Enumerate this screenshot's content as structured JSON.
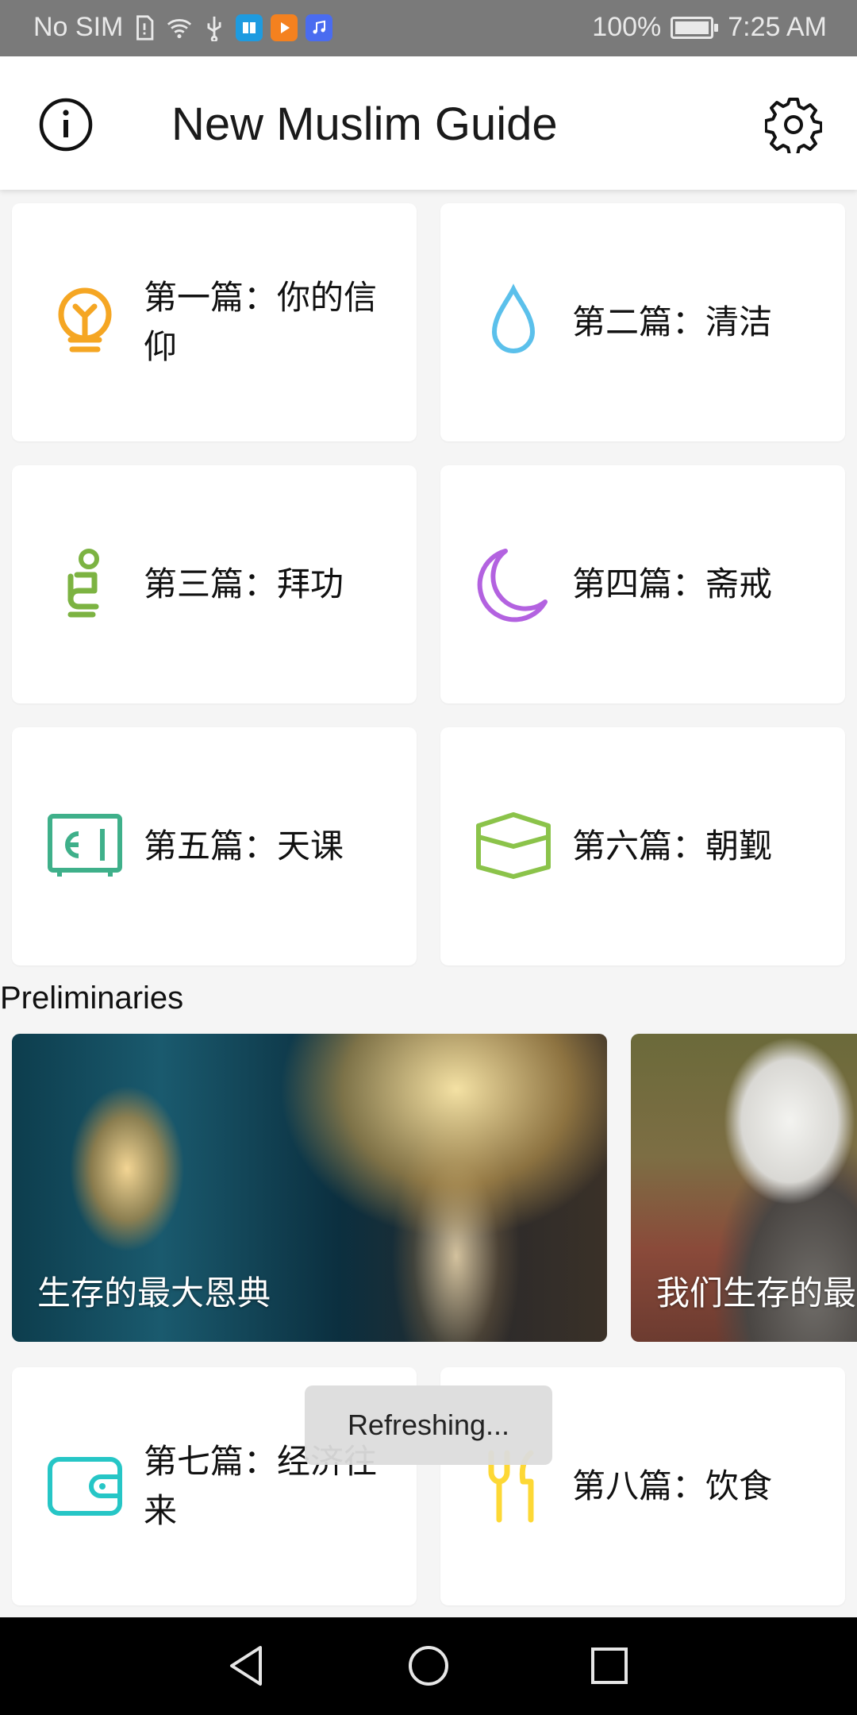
{
  "status_bar": {
    "carrier": "No SIM",
    "battery": "100%",
    "time": "7:25 AM"
  },
  "app_bar": {
    "title": "New Muslim Guide",
    "info_icon": "info-icon",
    "settings_icon": "gear-icon"
  },
  "sections": [
    {
      "label": "第一篇：你的信仰",
      "icon": "lightbulb-icon",
      "color": "#f5a623"
    },
    {
      "label": "第二篇：清洁",
      "icon": "water-drop-icon",
      "color": "#5bc0eb"
    },
    {
      "label": "第三篇：拜功",
      "icon": "prayer-posture-icon",
      "color": "#7cb342"
    },
    {
      "label": "第四篇：斋戒",
      "icon": "crescent-moon-icon",
      "color": "#b362e0"
    },
    {
      "label": "第五篇：天课",
      "icon": "safe-icon",
      "color": "#3fb08a"
    },
    {
      "label": "第六篇：朝觐",
      "icon": "kaaba-icon",
      "color": "#8bc34a"
    },
    {
      "label": "第七篇：经济往来",
      "icon": "wallet-icon",
      "color": "#26c6c6"
    },
    {
      "label": "第八篇：饮食",
      "icon": "utensils-icon",
      "color": "#fdd835"
    }
  ],
  "preliminaries": {
    "title": "Preliminaries",
    "items": [
      {
        "caption": "生存的最大恩典"
      },
      {
        "caption": "我们生存的最"
      }
    ]
  },
  "toast": "Refreshing..."
}
